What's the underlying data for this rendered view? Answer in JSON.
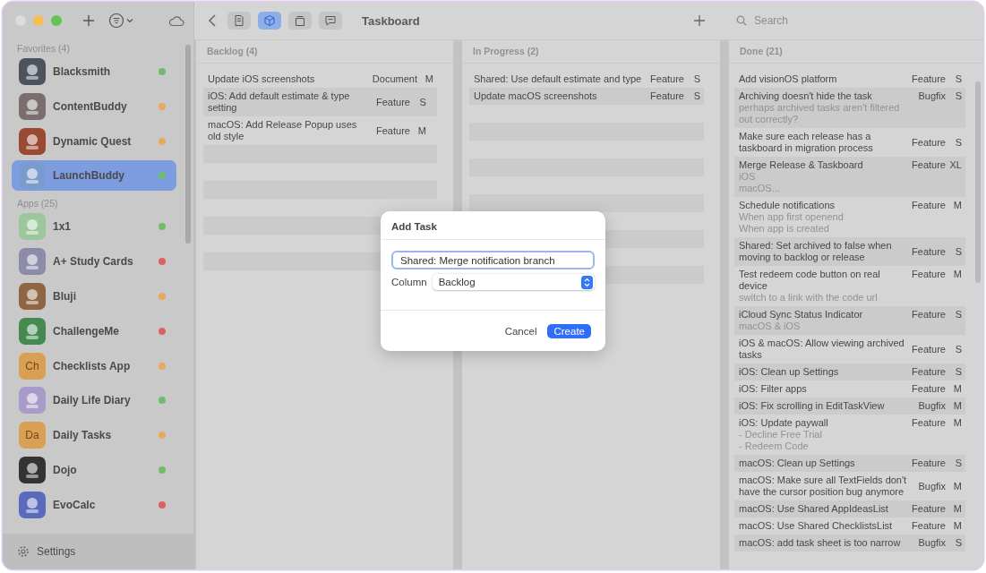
{
  "sidebar": {
    "sections": [
      {
        "title": "Favorites (4)",
        "items": [
          {
            "name": "Blacksmith",
            "color": "#6dbd6d",
            "selected": false
          },
          {
            "name": "ContentBuddy",
            "color": "#e6aa5e",
            "selected": false
          },
          {
            "name": "Dynamic Quest",
            "color": "#e6aa5e",
            "selected": false
          },
          {
            "name": "LaunchBuddy",
            "color": "#6dbd6d",
            "selected": true
          }
        ]
      },
      {
        "title": "Apps (25)",
        "items": [
          {
            "name": "1x1",
            "color": "#6dbd6d",
            "selected": false
          },
          {
            "name": "A+ Study Cards",
            "color": "#d9625e",
            "selected": false
          },
          {
            "name": "Bluji",
            "color": "#e6aa5e",
            "selected": false
          },
          {
            "name": "ChallengeMe",
            "color": "#d9625e",
            "selected": false
          },
          {
            "name": "Checklists App",
            "color": "#e6aa5e",
            "selected": false,
            "icon_text": "Ch"
          },
          {
            "name": "Daily Life Diary",
            "color": "#6dbd6d",
            "selected": false
          },
          {
            "name": "Daily Tasks",
            "color": "#e6aa5e",
            "selected": false,
            "icon_text": "Da"
          },
          {
            "name": "Dojo",
            "color": "#6dbd6d",
            "selected": false
          },
          {
            "name": "EvoCalc",
            "color": "#d9625e",
            "selected": false
          }
        ]
      }
    ],
    "settings": "Settings"
  },
  "toolbar": {
    "views": [
      {
        "selected": false
      },
      {
        "selected": true
      },
      {
        "selected": false
      },
      {
        "selected": false
      }
    ],
    "title": "Taskboard",
    "search": {
      "placeholder": "Search"
    }
  },
  "columns": [
    {
      "title": "Backlog (4)",
      "tasks": [
        {
          "title": "Update iOS screenshots",
          "type": "Document",
          "size": "M"
        },
        {
          "title": "iOS: Add default estimate & type setting",
          "type": "Feature",
          "size": "S"
        },
        {
          "title": "macOS: Add Release Popup uses old style",
          "type": "Feature",
          "size": "M"
        }
      ]
    },
    {
      "title": "In Progress (2)",
      "tasks": [
        {
          "title": "Shared: Use default estimate and type",
          "type": "Feature",
          "size": "S"
        },
        {
          "title": "Update macOS screenshots",
          "type": "Feature",
          "size": "S"
        }
      ]
    },
    {
      "title": "Done (21)",
      "tasks": [
        {
          "title": "Add visionOS platform",
          "type": "Feature",
          "size": "S"
        },
        {
          "title": "Archiving doesn't hide the task",
          "notes": [
            "perhaps archived tasks aren't filtered out correctly?"
          ],
          "type": "Bugfix",
          "size": "S"
        },
        {
          "title": "Make sure each release has a taskboard in migration process",
          "type": "Feature",
          "size": "S"
        },
        {
          "title": "Merge Release & Taskboard",
          "notes": [
            "iOS",
            "macOS..."
          ],
          "type": "Feature",
          "size": "XL"
        },
        {
          "title": "Schedule notifications",
          "notes": [
            "When app first openend",
            "When app is created"
          ],
          "type": "Feature",
          "size": "M"
        },
        {
          "title": "Shared: Set archived to false when moving to backlog or release",
          "type": "Feature",
          "size": "S"
        },
        {
          "title": "Test redeem code button on real device",
          "notes": [
            "switch to a link with the code url"
          ],
          "type": "Feature",
          "size": "M"
        },
        {
          "title": "iCloud Sync Status Indicator",
          "notes": [
            "macOS & iOS"
          ],
          "type": "Feature",
          "size": "S"
        },
        {
          "title": "iOS & macOS: Allow viewing archived tasks",
          "type": "Feature",
          "size": "S"
        },
        {
          "title": "iOS: Clean up Settings",
          "type": "Feature",
          "size": "S"
        },
        {
          "title": "iOS: Filter apps",
          "type": "Feature",
          "size": "M"
        },
        {
          "title": "iOS: Fix scrolling in EditTaskView",
          "type": "Bugfix",
          "size": "M"
        },
        {
          "title": "iOS: Update paywall",
          "notes": [
            "- Decline Free Trial",
            "- Redeem Code"
          ],
          "type": "Feature",
          "size": "M"
        },
        {
          "title": "macOS: Clean up Settings",
          "type": "Feature",
          "size": "S"
        },
        {
          "title": "macOS: Make sure all TextFields don't have the cursor position bug anymore",
          "type": "Bugfix",
          "size": "M"
        },
        {
          "title": "macOS: Use Shared AppIdeasList",
          "type": "Feature",
          "size": "M"
        },
        {
          "title": "macOS: Use Shared ChecklistsList",
          "type": "Feature",
          "size": "M"
        },
        {
          "title": "macOS: add task sheet is too narrow",
          "type": "Bugfix",
          "size": "S"
        }
      ]
    }
  ],
  "dialog": {
    "title": "Add Task",
    "name_value": "Shared: Merge notification branch",
    "column_label": "Column",
    "column_value": "Backlog",
    "buttons": [
      {
        "label": "Cancel",
        "kind": "plain"
      },
      {
        "label": "Create",
        "kind": "primary"
      }
    ]
  }
}
